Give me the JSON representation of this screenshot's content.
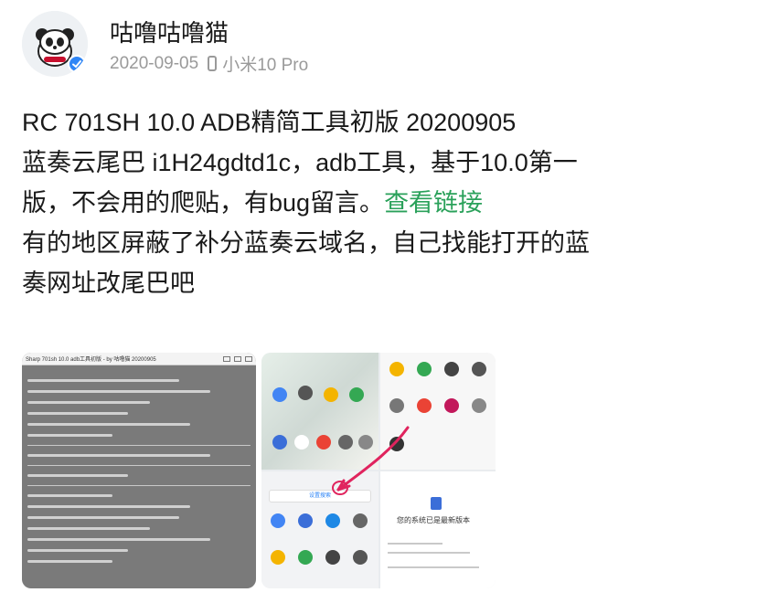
{
  "author": {
    "name": "咕噜咕噜猫",
    "date": "2020-09-05",
    "device": "小米10 Pro"
  },
  "post": {
    "line1": "RC 701SH 10.0 ADB精简工具初版 20200905",
    "line2": "蓝奏云尾巴 i1H24gdtd1c，adb工具，基于10.0第一",
    "line3": "版，不会用的爬贴，有bug留言。",
    "link": "查看链接",
    "line4": "有的地区屏蔽了补分蓝奏云域名，自己找能打开的蓝",
    "line5": "奏网址改尾巴吧"
  },
  "images": {
    "thumb1_title": "Sharp 701sh 10.0 adb工具初版 - by 咕噜猫 20200905",
    "thumb2_search": "设置搜索",
    "thumb2_update": "您的系统已是最新版本"
  },
  "colors": {
    "link": "#2aa15a",
    "verified_badge": "#2f86f6",
    "meta_text": "#9a9a9a"
  }
}
